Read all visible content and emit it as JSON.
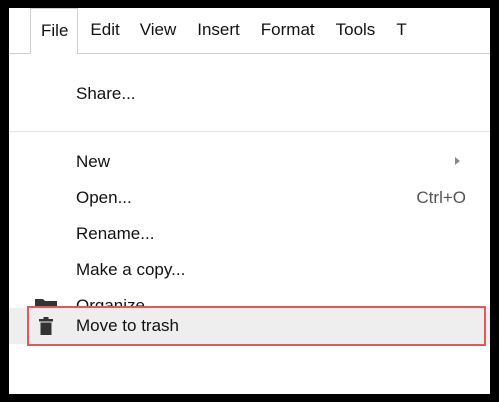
{
  "menubar": {
    "items": [
      {
        "label": "File",
        "active": true
      },
      {
        "label": "Edit"
      },
      {
        "label": "View"
      },
      {
        "label": "Insert"
      },
      {
        "label": "Format"
      },
      {
        "label": "Tools"
      },
      {
        "label": "T"
      }
    ]
  },
  "file_menu": {
    "share": "Share...",
    "new": "New",
    "open": "Open...",
    "open_shortcut": "Ctrl+O",
    "rename": "Rename...",
    "make_copy": "Make a copy...",
    "organize": "Organize...",
    "move_to_trash": "Move to trash"
  },
  "icons": {
    "organize": "folder-icon",
    "move_to_trash": "trash-icon",
    "new_submenu": "chevron-right-icon"
  },
  "colors": {
    "highlight_border": "#e05a5a",
    "hover_bg": "#eeeeee",
    "outer_frame": "#000000"
  }
}
